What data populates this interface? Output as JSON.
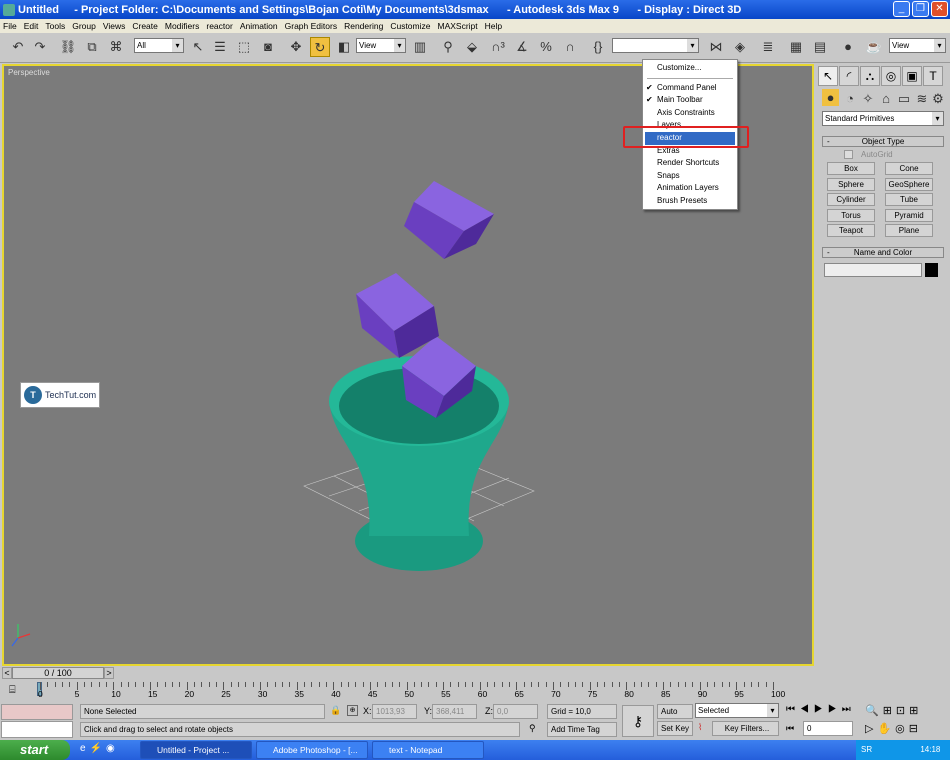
{
  "titlebar": {
    "title": "Untitled     - Project Folder: C:\\Documents and Settings\\Bojan Coti\\My Documents\\3dsmax      - Autodesk 3ds Max 9      - Display : Direct 3D"
  },
  "menubar": [
    "File",
    "Edit",
    "Tools",
    "Group",
    "Views",
    "Create",
    "Modifiers",
    "reactor",
    "Animation",
    "Graph Editors",
    "Rendering",
    "Customize",
    "MAXScript",
    "Help"
  ],
  "toolbar": {
    "selection_filter": "All",
    "ref_coord": "View",
    "named_selection": "",
    "ref_coord2": "View"
  },
  "viewport": {
    "label": "Perspective",
    "watermark": "TechTut.com",
    "bg": "#7b7b7b",
    "cube_color": "#6a3fc0",
    "vase_color": "#1fa88c"
  },
  "context_menu": {
    "items": [
      {
        "label": "Customize...",
        "checked": false
      },
      {
        "label": "Command Panel",
        "checked": true
      },
      {
        "label": "Main Toolbar",
        "checked": true
      },
      {
        "label": "Axis Constraints",
        "checked": false
      },
      {
        "label": "Layers",
        "checked": false
      },
      {
        "label": "reactor",
        "checked": false,
        "highlighted": true
      },
      {
        "label": "Extras",
        "checked": false
      },
      {
        "label": "Render Shortcuts",
        "checked": false
      },
      {
        "label": "Snaps",
        "checked": false
      },
      {
        "label": "Animation Layers",
        "checked": false
      },
      {
        "label": "Brush Presets",
        "checked": false
      }
    ],
    "check": "✔",
    "highlight_color": "#316ac5",
    "annotation_color": "#e02020"
  },
  "command_panel": {
    "category": "Standard Primitives",
    "object_type": "Object Type",
    "autogrid": "AutoGrid",
    "buttons": [
      "Box",
      "Cone",
      "Sphere",
      "GeoSphere",
      "Cylinder",
      "Tube",
      "Torus",
      "Pyramid",
      "Teapot",
      "Plane"
    ],
    "name_and_color": "Name and Color",
    "name_value": "",
    "color": "#000000",
    "minus": "-"
  },
  "timeslider": {
    "label": "0 / 100",
    "prev": "<",
    "next": ">"
  },
  "track": {
    "ticks": [
      "0",
      "5",
      "10",
      "15",
      "20",
      "25",
      "30",
      "35",
      "40",
      "45",
      "50",
      "55",
      "60",
      "65",
      "70",
      "75",
      "80",
      "85",
      "90",
      "95",
      "100"
    ]
  },
  "status": {
    "selection": "None Selected",
    "prompt": "Click and drag to select and rotate objects",
    "x_label": "X:",
    "x": "1013,93",
    "y_label": "Y:",
    "y": "368,411",
    "z_label": "Z:",
    "z": "0,0",
    "grid": "Grid = 10,0",
    "add_time_tag": "Add Time Tag",
    "auto_key": "Auto Key",
    "set_key": "Set Key",
    "key_mode": "Selected",
    "key_filters": "Key Filters...",
    "frame": "0"
  },
  "taskbar": {
    "start": "start",
    "tasks": [
      "Untitled    - Project ...",
      "Adobe Photoshop - [...",
      "text - Notepad"
    ],
    "lang": "SR",
    "clock": "14:18"
  }
}
